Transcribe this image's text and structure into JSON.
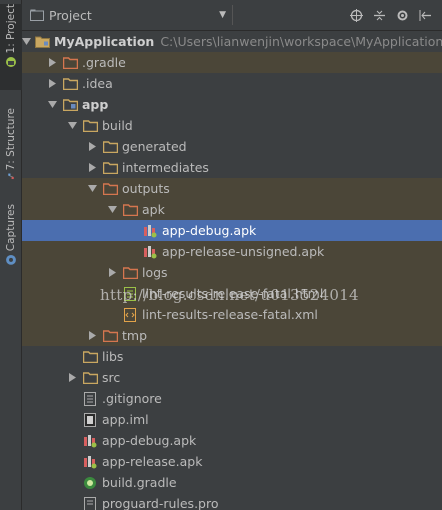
{
  "header": {
    "project_select": "Project",
    "icons": [
      "target-icon",
      "collapse-icon",
      "settings-icon",
      "hide-icon"
    ]
  },
  "side_tabs": [
    {
      "label": "1: Project"
    },
    {
      "label": "7: Structure"
    },
    {
      "label": "Captures"
    }
  ],
  "tree": {
    "root": {
      "label": "MyApplication",
      "path": "C:\\Users\\lianwenjin\\workspace\\MyApplication"
    },
    "gradle_dir": ".gradle",
    "idea_dir": ".idea",
    "app": "app",
    "build": "build",
    "generated": "generated",
    "intermediates": "intermediates",
    "outputs": "outputs",
    "apk": "apk",
    "apk_debug": "app-debug.apk",
    "apk_release_unsigned": "app-release-unsigned.apk",
    "logs": "logs",
    "lint_html": "lint-results-release-fatal.html",
    "lint_xml": "lint-results-release-fatal.xml",
    "tmp": "tmp",
    "libs": "libs",
    "src": "src",
    "gitignore": ".gitignore",
    "app_iml": "app.iml",
    "app_debug_apk": "app-debug.apk",
    "app_release_apk": "app-release.apk",
    "build_gradle": "build.gradle",
    "proguard": "proguard-rules.pro"
  },
  "watermark": "http://blog.csdn.net/u013524014",
  "colors": {
    "background": "#3c3f41",
    "selection": "#4b6eaf",
    "excluded_highlight": "#4b4638",
    "excluded_folder": "#d5764f",
    "folder": "#c9a761"
  }
}
